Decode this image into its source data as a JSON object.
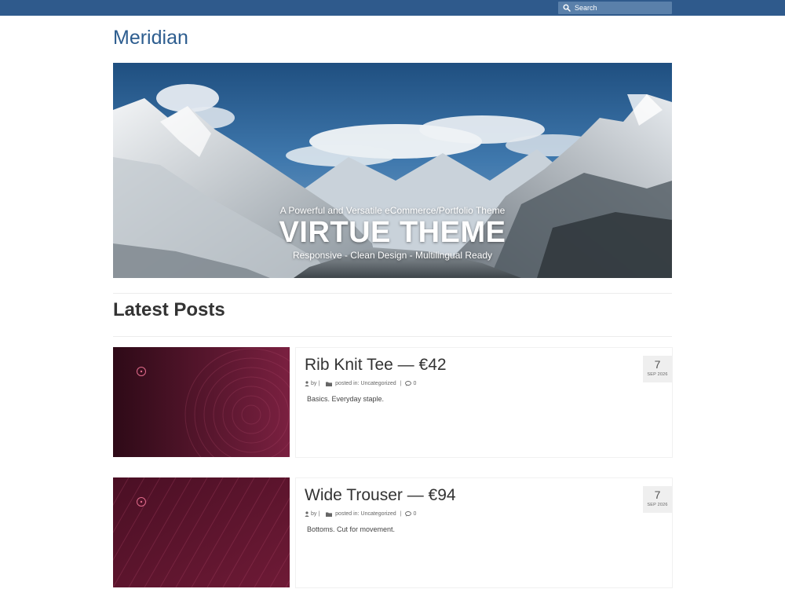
{
  "header": {
    "search_placeholder": "Search"
  },
  "site": {
    "title": "Meridian"
  },
  "hero": {
    "tagline": "A Powerful and Versatile eCommerce/Portfolio Theme",
    "heading": "VIRTUE THEME",
    "subline": "Responsive - Clean Design - Multilingual Ready"
  },
  "section": {
    "title": "Latest Posts"
  },
  "posts": [
    {
      "title": "Rib Knit Tee — €42",
      "by": "by |",
      "posted_in": "posted in:",
      "category": "Uncategorized",
      "separator": "|",
      "comments": "0",
      "excerpt": "Basics. Everyday staple.",
      "day": "7",
      "month": "SEP 2026",
      "thumb_style": "concentric-circles"
    },
    {
      "title": "Wide Trouser — €94",
      "by": "by |",
      "posted_in": "posted in:",
      "category": "Uncategorized",
      "separator": "|",
      "comments": "0",
      "excerpt": "Bottoms. Cut for movement.",
      "day": "7",
      "month": "SEP 2026",
      "thumb_style": "diagonal-lines"
    }
  ],
  "colors": {
    "topbar": "#2f5a8c",
    "site_title": "#2d5d8f",
    "thumb_dark": "#3a0f1f",
    "thumb_accent": "#8a2444"
  }
}
